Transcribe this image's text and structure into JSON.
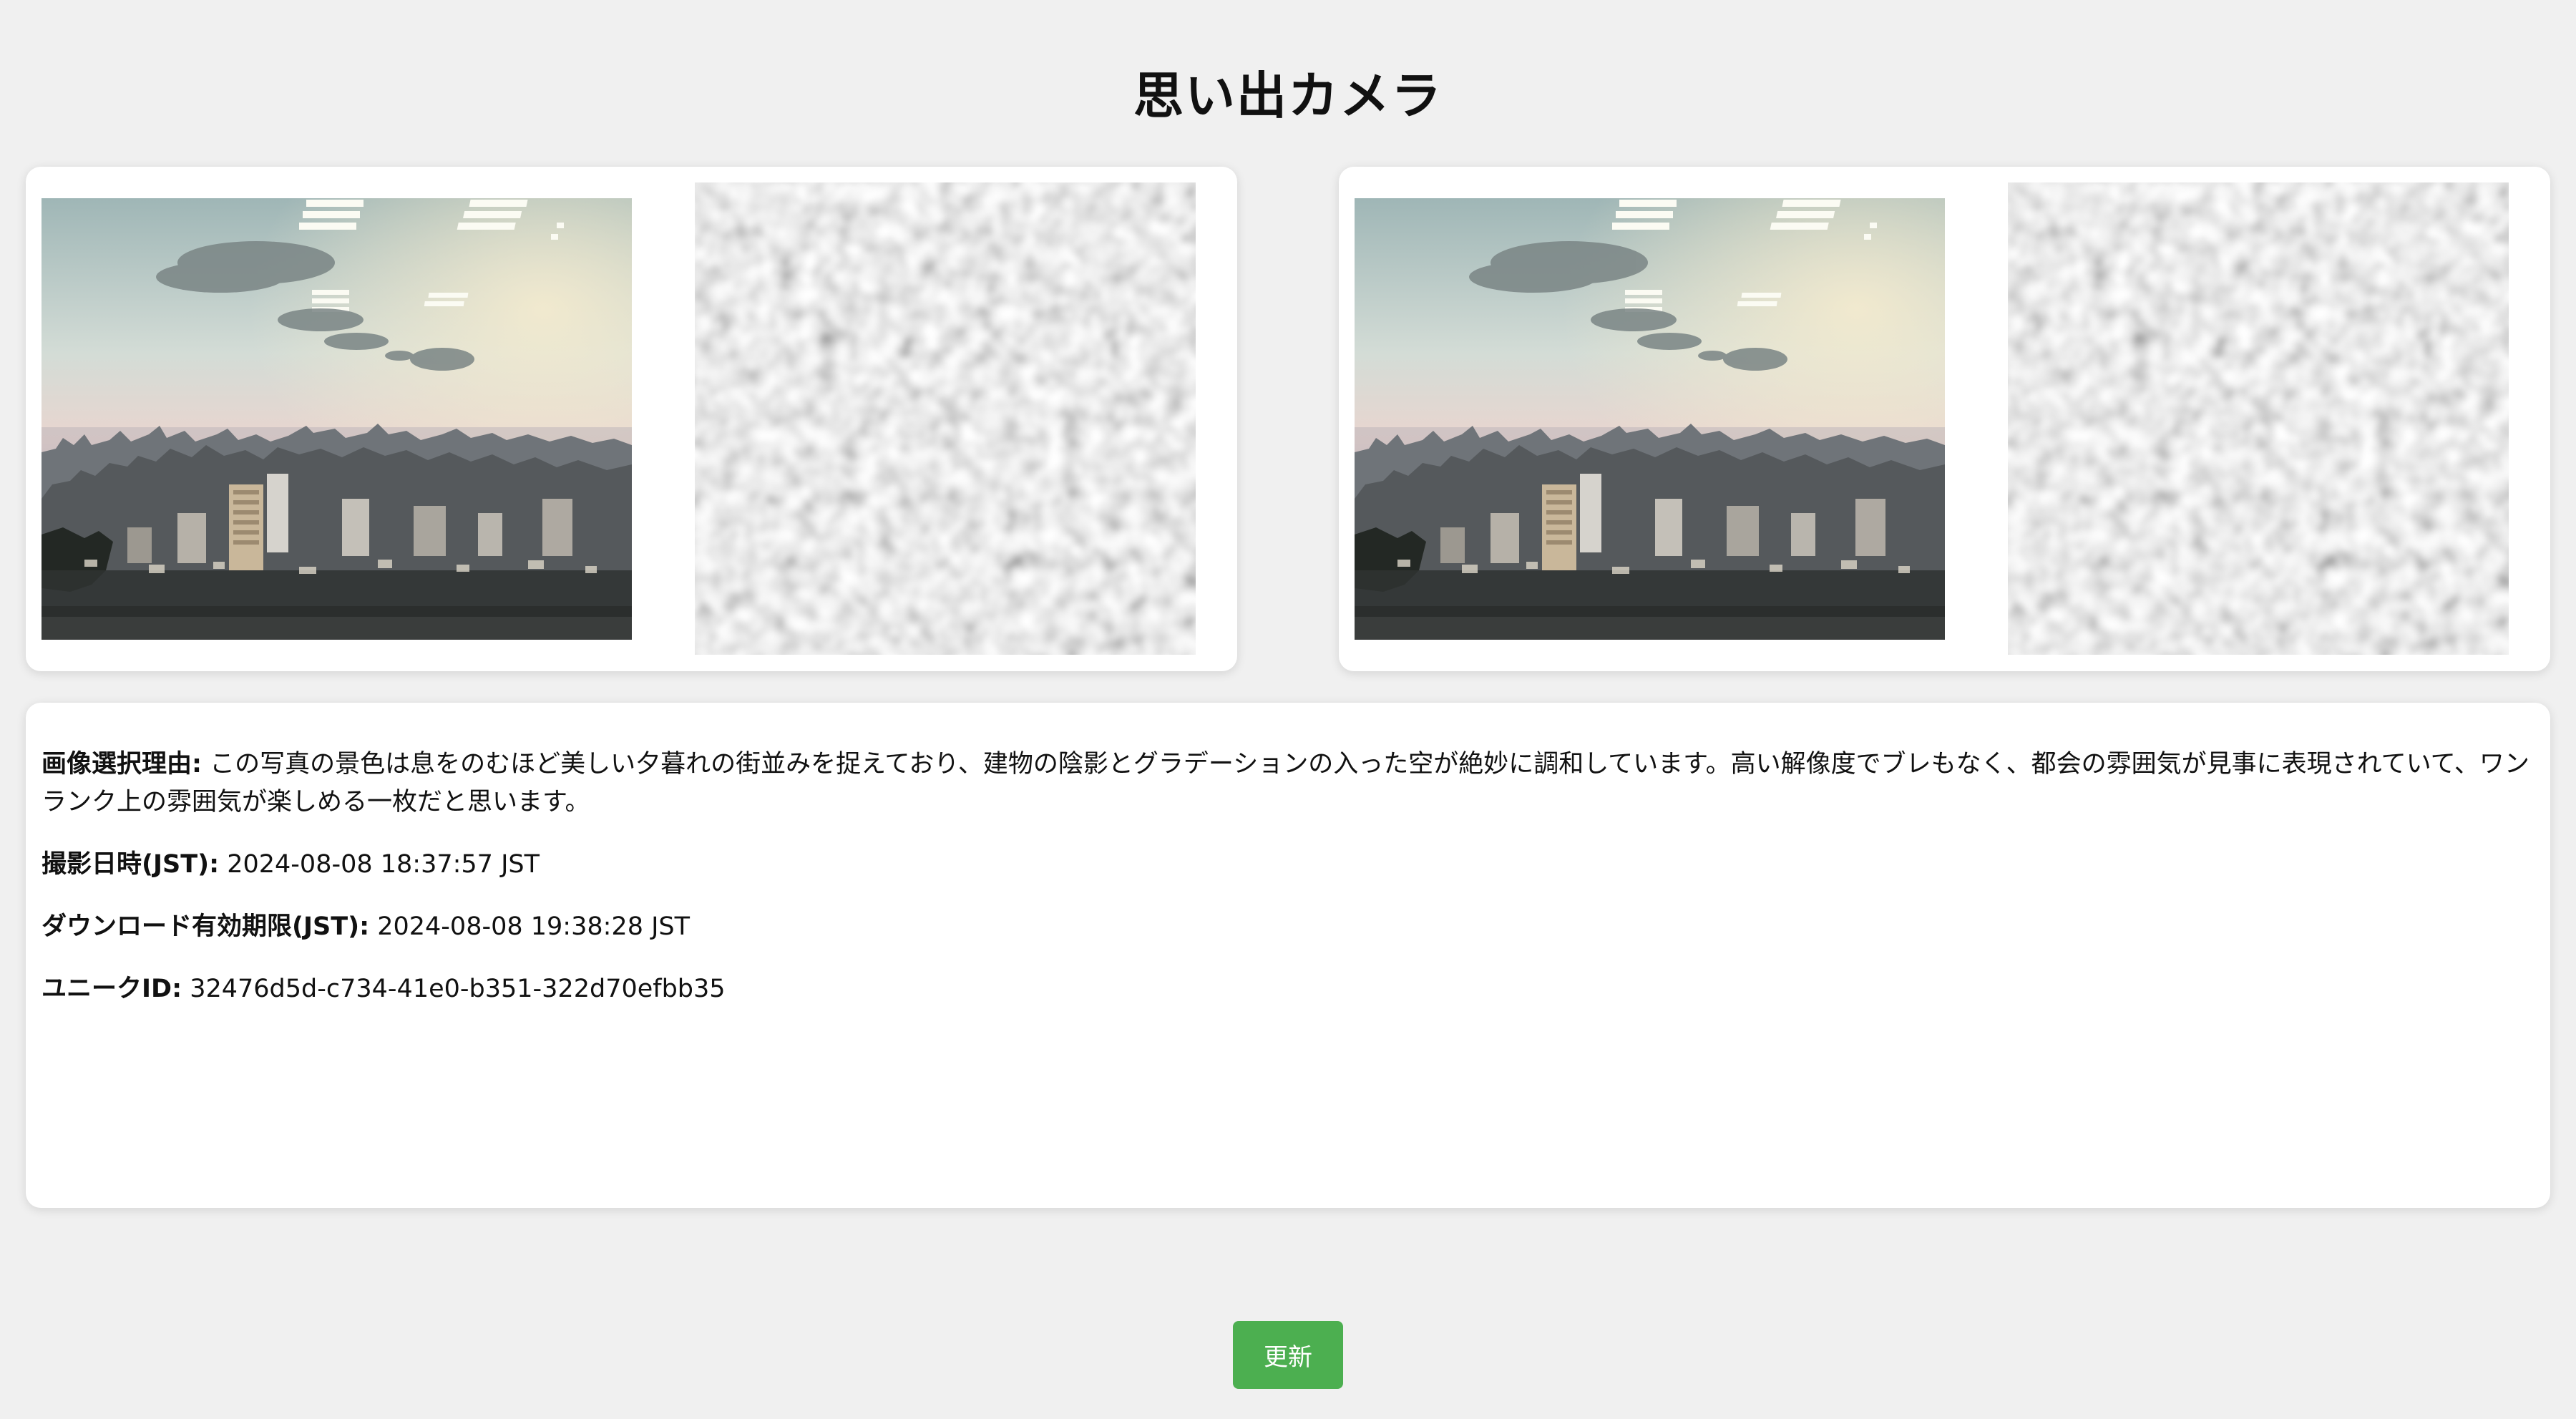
{
  "app": {
    "title": "思い出カメラ"
  },
  "photos": [
    {
      "image_alt": "夕暮れの街並み"
    },
    {
      "image_alt": "夕暮れの街並み"
    }
  ],
  "info": {
    "reason_label": "画像選択理由:",
    "reason_text": " この写真の景色は息をのむほど美しい夕暮れの街並みを捉えており、建物の陰影とグラデーションの入った空が絶妙に調和しています。高い解像度でブレもなく、都会の雰囲気が見事に表現されていて、ワンランク上の雰囲気が楽しめる一枚だと思います。",
    "taken_label": "撮影日時(JST):",
    "taken_value": " 2024-08-08 18:37:57 JST",
    "expiry_label": "ダウンロード有効期限(JST):",
    "expiry_value": " 2024-08-08 19:38:28 JST",
    "id_label": "ユニークID:",
    "id_value": " 32476d5d-c734-41e0-b351-322d70efbb35"
  },
  "actions": {
    "refresh_label": "更新"
  },
  "colors": {
    "background": "#f0f0f0",
    "card": "#ffffff",
    "button": "#4caf50",
    "button_text": "#ffffff"
  },
  "icons": {
    "qr": "qr-code-icon"
  }
}
